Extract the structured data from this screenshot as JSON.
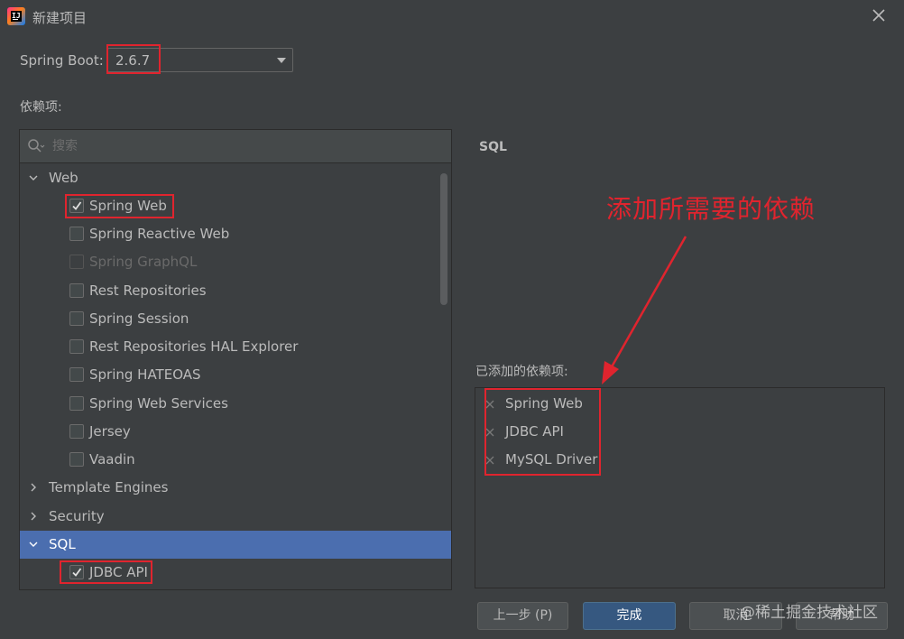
{
  "window": {
    "title": "新建项目"
  },
  "spring_boot": {
    "label": "Spring Boot:",
    "version": "2.6.7"
  },
  "dependencies": {
    "label": "依赖项:",
    "search_placeholder": "搜索",
    "categories": [
      {
        "label": "Web",
        "expanded": true,
        "items": [
          {
            "label": "Spring Web",
            "checked": true,
            "disabled": false
          },
          {
            "label": "Spring Reactive Web",
            "checked": false,
            "disabled": false
          },
          {
            "label": "Spring GraphQL",
            "checked": false,
            "disabled": true
          },
          {
            "label": "Rest Repositories",
            "checked": false,
            "disabled": false
          },
          {
            "label": "Spring Session",
            "checked": false,
            "disabled": false
          },
          {
            "label": "Rest Repositories HAL Explorer",
            "checked": false,
            "disabled": false
          },
          {
            "label": "Spring HATEOAS",
            "checked": false,
            "disabled": false
          },
          {
            "label": "Spring Web Services",
            "checked": false,
            "disabled": false
          },
          {
            "label": "Jersey",
            "checked": false,
            "disabled": false
          },
          {
            "label": "Vaadin",
            "checked": false,
            "disabled": false
          }
        ]
      },
      {
        "label": "Template Engines",
        "expanded": false,
        "items": []
      },
      {
        "label": "Security",
        "expanded": false,
        "items": []
      },
      {
        "label": "SQL",
        "expanded": true,
        "selected": true,
        "items": [
          {
            "label": "JDBC API",
            "checked": true,
            "disabled": false
          }
        ]
      }
    ]
  },
  "detail": {
    "title": "SQL"
  },
  "annotation": {
    "text": "添加所需要的依赖"
  },
  "added": {
    "label": "已添加的依赖项:",
    "items": [
      "Spring Web",
      "JDBC API",
      "MySQL Driver"
    ]
  },
  "buttons": {
    "previous": "上一步 (P)",
    "finish": "完成",
    "cancel": "取消",
    "help": "帮助"
  },
  "watermark": "@稀土掘金技术社区",
  "colors": {
    "background": "#3c3f41",
    "selection": "#4b6eaf",
    "primary_button": "#365880",
    "annotation_red": "#e0242e"
  }
}
